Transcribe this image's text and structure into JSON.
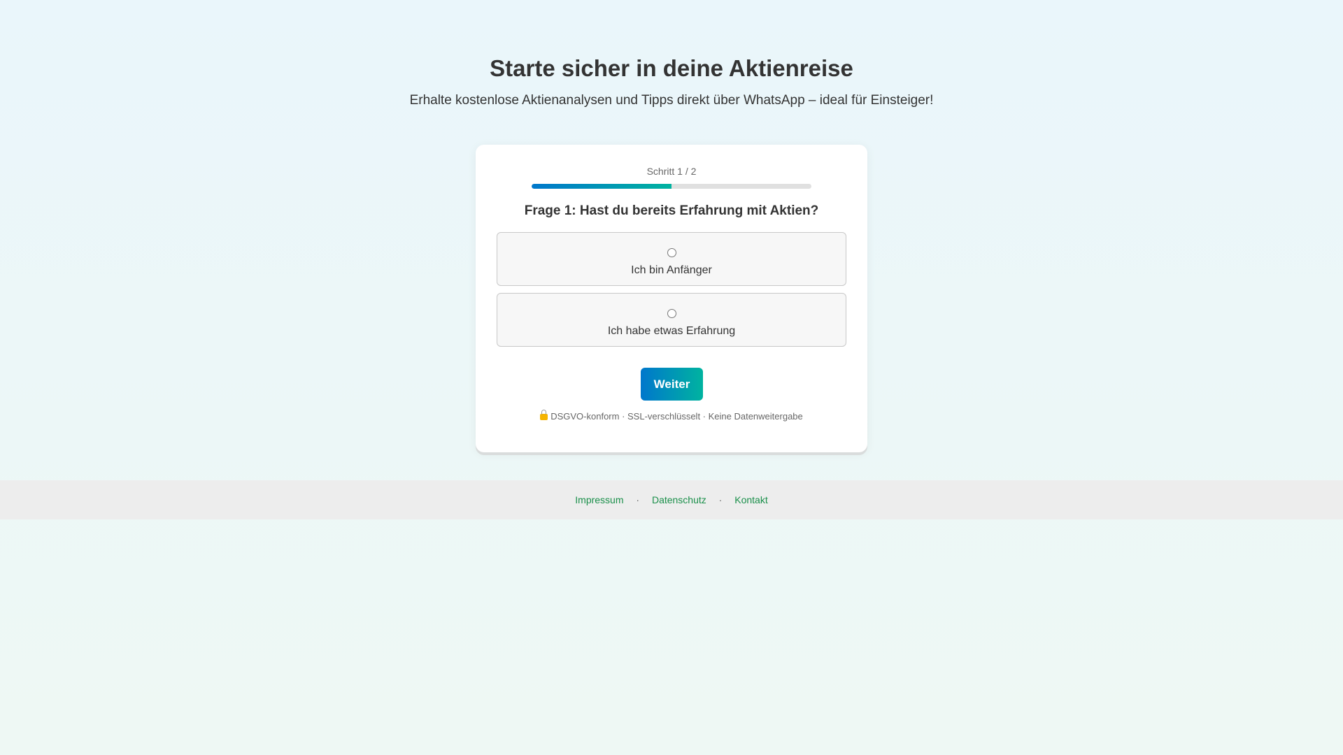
{
  "hero": {
    "title": "Starte sicher in deine Aktienreise",
    "subtitle": "Erhalte kostenlose Aktienanalysen und Tipps direkt über WhatsApp – ideal für Einsteiger!"
  },
  "quiz": {
    "step_label": "Schritt 1 / 2",
    "progress_fraction": 0.5,
    "question": "Frage 1: Hast du bereits Erfahrung mit Aktien?",
    "options": [
      {
        "label": "Ich bin Anfänger",
        "selected": false
      },
      {
        "label": "Ich habe etwas Erfahrung",
        "selected": false
      }
    ],
    "next_label": "Weiter",
    "trust_icon": "lock-icon",
    "trust_text": "DSGVO-konform · SSL-verschlüsselt · Keine Datenweitergabe"
  },
  "footer": {
    "links": [
      "Impressum",
      "Datenschutz",
      "Kontakt"
    ],
    "separator": "·"
  },
  "colors": {
    "accent_start": "#0077cc",
    "accent_end": "#00b3a0",
    "footer_link": "#1a8f4a"
  }
}
